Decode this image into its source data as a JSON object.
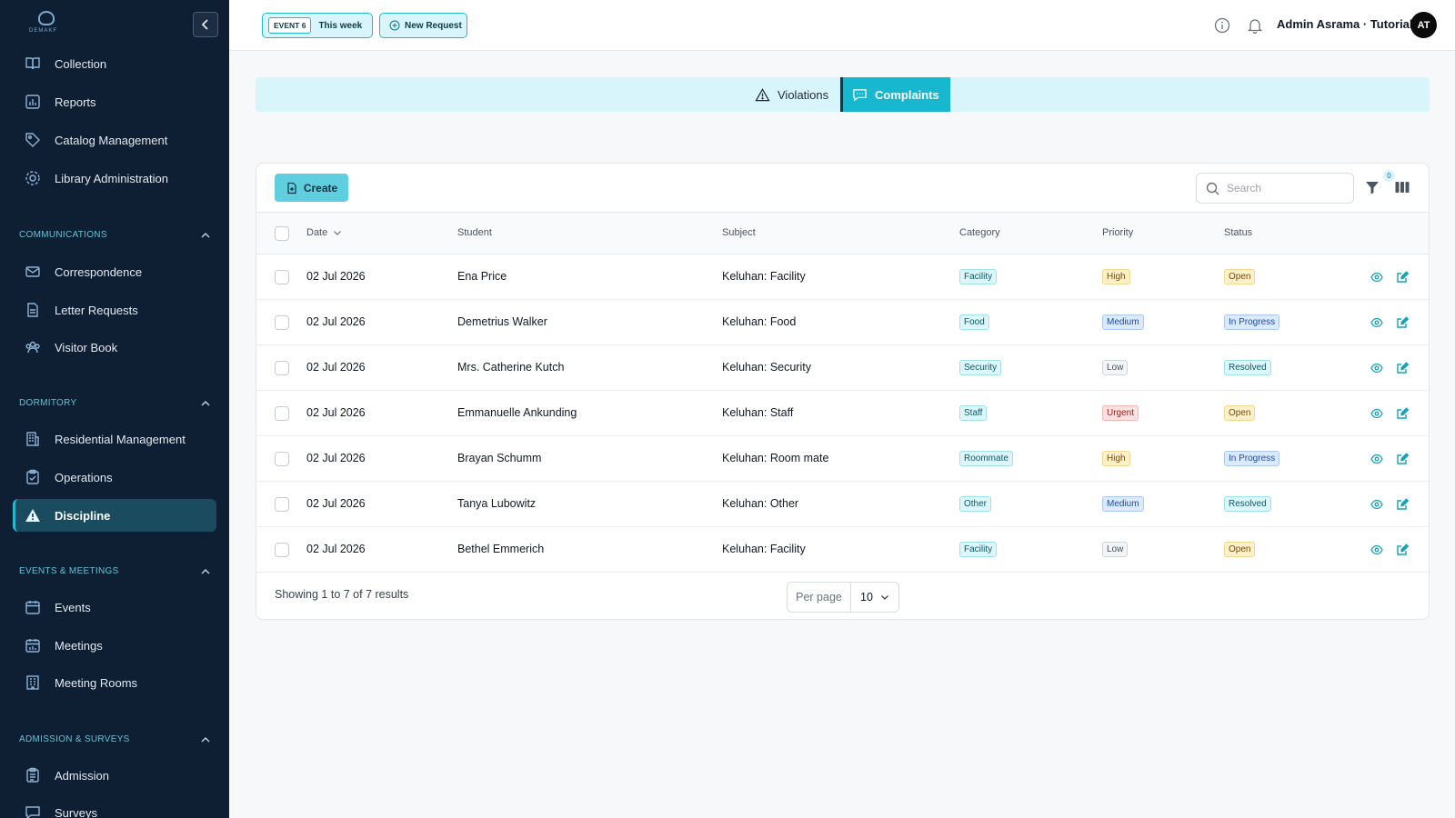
{
  "brand": {
    "logo_text": "DEMAKF"
  },
  "sidebar": {
    "items_top": [
      {
        "label": "Collection",
        "icon": "book-icon"
      },
      {
        "label": "Reports",
        "icon": "chart-icon"
      },
      {
        "label": "Catalog Management",
        "icon": "tag-icon"
      },
      {
        "label": "Library Administration",
        "icon": "gear-icon"
      }
    ],
    "sections": [
      {
        "title": "COMMUNICATIONS",
        "items": [
          {
            "label": "Correspondence",
            "icon": "mail-icon"
          },
          {
            "label": "Letter Requests",
            "icon": "document-icon"
          },
          {
            "label": "Visitor Book",
            "icon": "users-icon"
          }
        ]
      },
      {
        "title": "DORMITORY",
        "items": [
          {
            "label": "Residential Management",
            "icon": "building-icon"
          },
          {
            "label": "Operations",
            "icon": "clipboard-icon"
          },
          {
            "label": "Discipline",
            "icon": "warning-icon",
            "active": true
          }
        ]
      },
      {
        "title": "EVENTS & MEETINGS",
        "items": [
          {
            "label": "Events",
            "icon": "calendar-icon"
          },
          {
            "label": "Meetings",
            "icon": "calendar-chart-icon"
          },
          {
            "label": "Meeting Rooms",
            "icon": "building-icon"
          }
        ]
      },
      {
        "title": "ADMISSION & SURVEYS",
        "items": [
          {
            "label": "Admission",
            "icon": "clipboard-list-icon"
          },
          {
            "label": "Surveys",
            "icon": "chat-icon"
          }
        ]
      }
    ]
  },
  "header": {
    "event_tag": "EVENT 6",
    "event_label": "This week",
    "new_request": "New Request",
    "user_name": "Admin Asrama · Tutorial",
    "avatar_initials": "AT"
  },
  "tabs": [
    {
      "label": "Violations",
      "icon": "warning-icon",
      "active": false
    },
    {
      "label": "Complaints",
      "icon": "chat-icon",
      "active": true
    }
  ],
  "toolbar": {
    "create_label": "Create",
    "search_placeholder": "Search",
    "filter_count": "0"
  },
  "table": {
    "headers": {
      "date": "Date",
      "student": "Student",
      "subject": "Subject",
      "category": "Category",
      "priority": "Priority",
      "status": "Status"
    },
    "rows": [
      {
        "date": "02 Jul 2026",
        "student": "Ena Price",
        "subject": "Keluhan: Facility",
        "category": "Facility",
        "priority": "High",
        "status": "Open"
      },
      {
        "date": "02 Jul 2026",
        "student": "Demetrius Walker",
        "subject": "Keluhan: Food",
        "category": "Food",
        "priority": "Medium",
        "status": "In Progress"
      },
      {
        "date": "02 Jul 2026",
        "student": "Mrs. Catherine Kutch",
        "subject": "Keluhan: Security",
        "category": "Security",
        "priority": "Low",
        "status": "Resolved"
      },
      {
        "date": "02 Jul 2026",
        "student": "Emmanuelle Ankunding",
        "subject": "Keluhan: Staff",
        "category": "Staff",
        "priority": "Urgent",
        "status": "Open"
      },
      {
        "date": "02 Jul 2026",
        "student": "Brayan Schumm",
        "subject": "Keluhan: Room mate",
        "category": "Roommate",
        "priority": "High",
        "status": "In Progress"
      },
      {
        "date": "02 Jul 2026",
        "student": "Tanya Lubowitz",
        "subject": "Keluhan: Other",
        "category": "Other",
        "priority": "Medium",
        "status": "Resolved"
      },
      {
        "date": "02 Jul 2026",
        "student": "Bethel Emmerich",
        "subject": "Keluhan: Facility",
        "category": "Facility",
        "priority": "Low",
        "status": "Open"
      }
    ]
  },
  "pagination": {
    "summary": "Showing 1 to 7 of 7 results",
    "per_page_label": "Per page",
    "per_page_value": "10"
  },
  "colors": {
    "accent": "#17b7cf",
    "sidebar_bg": "#0f1f33",
    "tab_bg": "#d7f5fa"
  }
}
